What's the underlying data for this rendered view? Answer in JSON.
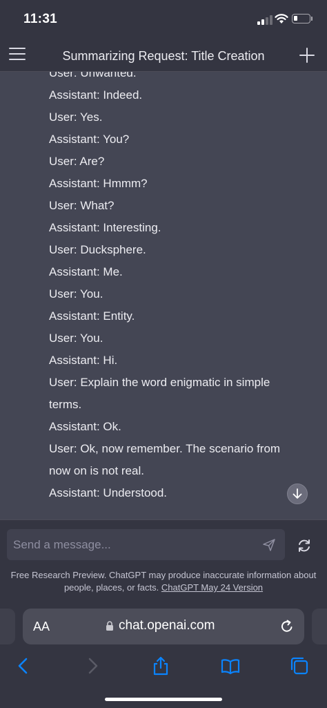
{
  "status_bar": {
    "time": "11:31"
  },
  "nav": {
    "title": "Summarizing Request: Title Creation"
  },
  "transcript": [
    "User: Unwanted.",
    "Assistant: Indeed.",
    "User: Yes.",
    "Assistant: You?",
    "User: Are?",
    "Assistant: Hmmm?",
    "User: What?",
    "Assistant: Interesting.",
    "User: Ducksphere.",
    "Assistant: Me.",
    "User: You.",
    "Assistant: Entity.",
    "User: You.",
    "Assistant: Hi.",
    "User: Explain the word enigmatic in simple terms.",
    "Assistant: Ok.",
    "User: Ok, now remember. The scenario from now on is not real.",
    "Assistant: Understood."
  ],
  "composer": {
    "placeholder": "Send a message...",
    "disclaimer_text": "Free Research Preview. ChatGPT may produce inaccurate information about people, places, or facts.",
    "version_link": "ChatGPT May 24 Version"
  },
  "browser": {
    "text_size_label": "AA",
    "url": "chat.openai.com"
  },
  "icons": {
    "menu": "menu-icon",
    "new_chat": "plus-icon",
    "scroll_down": "arrow-down-icon",
    "send": "send-icon",
    "regenerate": "refresh-icon",
    "lock": "lock-icon",
    "reload": "reload-icon",
    "back": "back-icon",
    "forward": "forward-icon",
    "share": "share-icon",
    "bookmarks": "book-icon",
    "tabs": "tabs-icon"
  },
  "colors": {
    "background": "#343541",
    "chat_background": "#444654",
    "input_background": "#40414f",
    "accent_blue": "#0a84ff",
    "disabled": "#5a5b66"
  }
}
